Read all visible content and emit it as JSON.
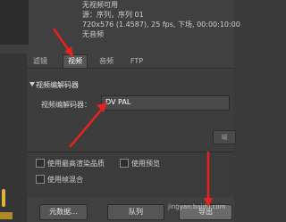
{
  "info": {
    "line1": "无视频可用",
    "line2": "源：序列，序列 01",
    "line3": "720x576 (1.4587), 25 fps, 下场, 00:00:10:00",
    "line4": "无音频"
  },
  "tabs": [
    {
      "label": "滤镜"
    },
    {
      "label": "视频"
    },
    {
      "label": "音频"
    },
    {
      "label": "FTP"
    }
  ],
  "section": {
    "title": "视频编解码器",
    "codec_label": "视频编解码器：",
    "codec_value": "DV PAL",
    "settings_label": "编"
  },
  "checkboxes": [
    {
      "label": "使用最高渲染品质"
    },
    {
      "label": "使用预览"
    },
    {
      "label": "使用帧混合"
    }
  ],
  "buttons": {
    "metadata": "元数据...",
    "queue": "队列",
    "export": "导出"
  },
  "watermark": "jingyan.baidu.com",
  "colors": {
    "arrow": "#e8231f",
    "panel": "#404040"
  }
}
